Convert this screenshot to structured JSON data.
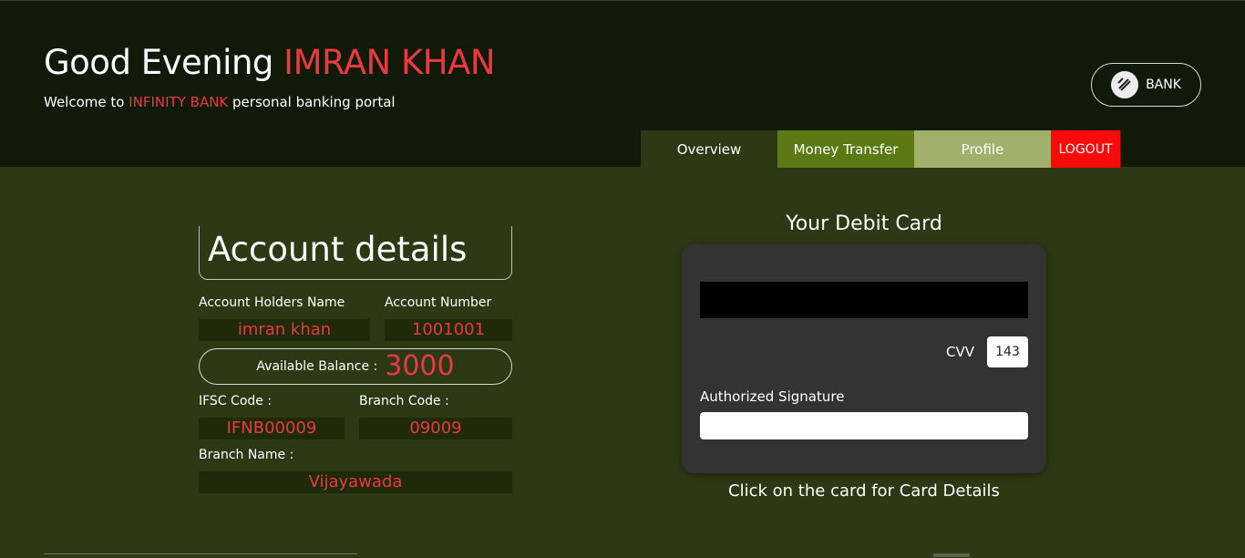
{
  "header": {
    "greeting_prefix": "Good Evening ",
    "user_name": "IMRAN KHAN",
    "welcome_prefix": "Welcome to ",
    "bank_name": "INFINITY BANK",
    "welcome_suffix": " personal banking portal",
    "bank_button_label": "BANK",
    "bank_logo_icon": "bank-logo-icon"
  },
  "nav": {
    "overview": "Overview",
    "money_transfer": "Money Transfer",
    "profile": "Profile",
    "logout": "LOGOUT"
  },
  "account": {
    "title": "Account details",
    "holder_name_label": "Account Holders Name",
    "holder_name": "imran khan",
    "account_number_label": "Account Number",
    "account_number": "1001001",
    "balance_label": "Available Balance :",
    "balance": "3000",
    "ifsc_label": "IFSC Code :",
    "ifsc": "IFNB00009",
    "branch_code_label": "Branch Code :",
    "branch_code": "09009",
    "branch_name_label": "Branch Name :",
    "branch_name": "Vijayawada"
  },
  "card": {
    "heading": "Your Debit Card",
    "cvv_label": "CVV",
    "cvv": "143",
    "signature_label": "Authorized Signature",
    "hint": "Click on the card for Card Details"
  },
  "colors": {
    "header_bg": "#111a09",
    "page_bg": "#2d3815",
    "accent_red": "#e83a3f",
    "money_transfer_tab": "#5c7a14",
    "profile_tab": "#a2b06c",
    "logout_tab": "#fc0a0a",
    "card_bg": "#333333"
  }
}
